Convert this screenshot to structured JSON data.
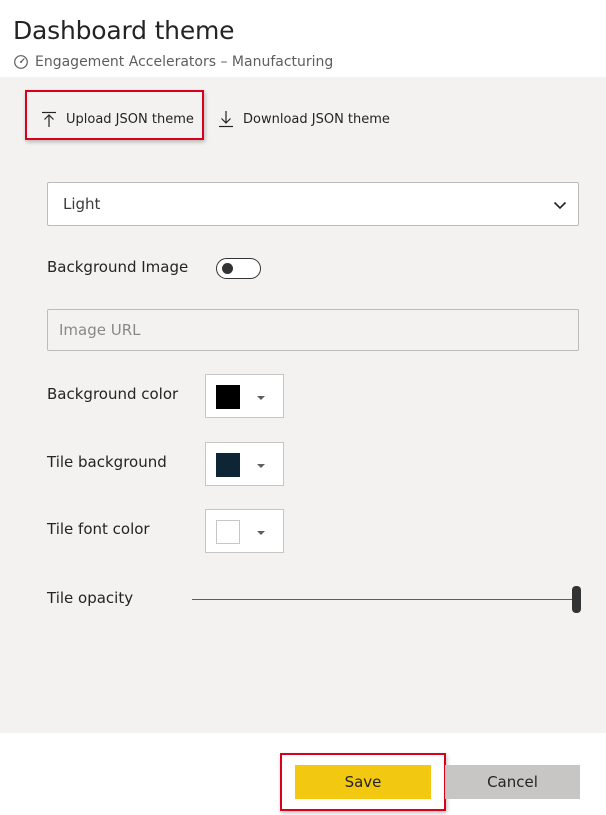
{
  "header": {
    "title": "Dashboard theme",
    "subtitle": "Engagement Accelerators – Manufacturing",
    "subtitle_icon": "dashboard-gauge-icon"
  },
  "actions": {
    "upload_label": "Upload JSON theme",
    "upload_icon": "upload-arrow-icon",
    "download_label": "Download JSON theme",
    "download_icon": "download-arrow-icon"
  },
  "theme_select": {
    "selected": "Light",
    "icon": "chevron-down-icon"
  },
  "background_image": {
    "label": "Background Image",
    "enabled": false,
    "url_placeholder": "Image URL",
    "url_value": ""
  },
  "colors": [
    {
      "label": "Background color",
      "value": "#000000"
    },
    {
      "label": "Tile background",
      "value": "#0d2535"
    },
    {
      "label": "Tile font color",
      "value": "#ffffff"
    }
  ],
  "tile_opacity": {
    "label": "Tile opacity",
    "value_fraction": 1.0
  },
  "footer": {
    "save_label": "Save",
    "cancel_label": "Cancel"
  },
  "accent_colors": {
    "save": "#f2c811",
    "cancel": "#c8c6c4",
    "highlight": "#d9001b",
    "panel": "#f3f2f1"
  }
}
